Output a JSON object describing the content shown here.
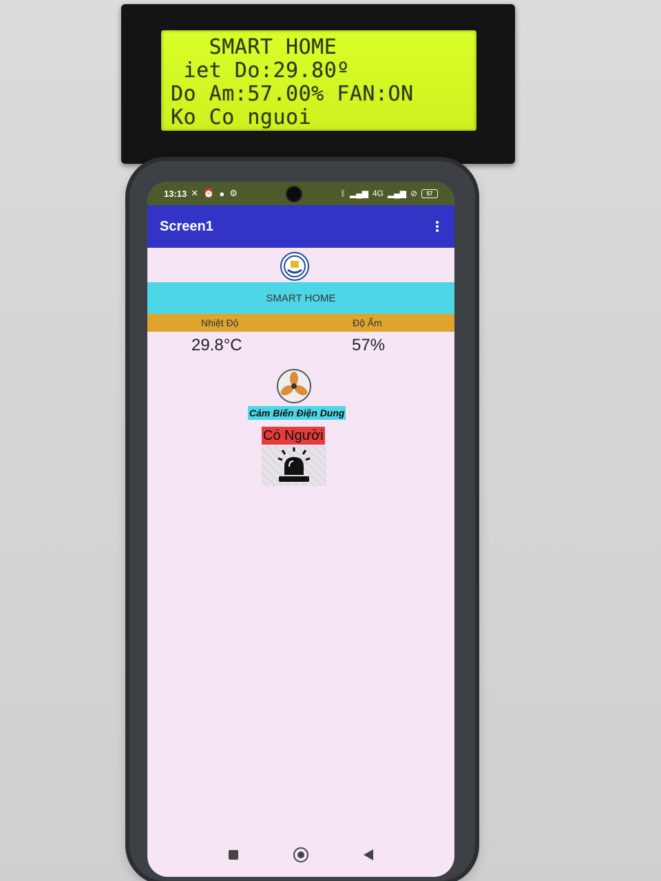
{
  "lcd": {
    "lines": [
      "   SMART HOME",
      " iet Do:29.80º",
      "Do Am:57.00% FAN:ON",
      "Ko Co nguoi"
    ]
  },
  "status_bar": {
    "time": "13:13",
    "network": "4G",
    "battery": "57"
  },
  "app_bar": {
    "title": "Screen1"
  },
  "main": {
    "banner": "SMART HOME",
    "temperature_label": "Nhiệt Độ",
    "humidity_label": "Độ Ẩm",
    "temperature_value": "29.8°C",
    "humidity_value": "57%",
    "sensor_label": "Cảm Biến Điện Dung",
    "presence_status": "Có Người"
  },
  "colors": {
    "app_bar": "#3134c4",
    "banner": "#4dd7e6",
    "labels_row": "#dea42e",
    "presence_badge": "#e73c3c",
    "lcd_backlight": "#d9ff2a"
  },
  "icons": [
    "logo-icon",
    "fan-icon",
    "alarm-light-icon",
    "overflow-menu-icon"
  ]
}
